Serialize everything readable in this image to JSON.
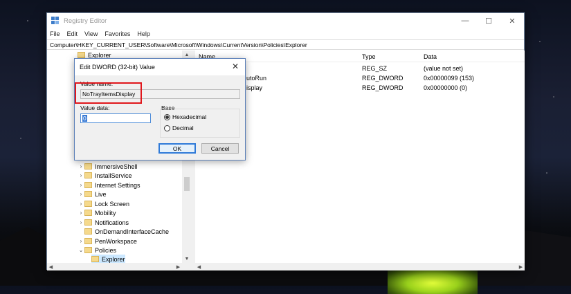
{
  "window": {
    "title": "Registry Editor",
    "controls": {
      "minimize": "—",
      "maximize": "☐",
      "close": "✕"
    }
  },
  "menu": [
    "File",
    "Edit",
    "View",
    "Favorites",
    "Help"
  ],
  "address": "Computer\\HKEY_CURRENT_USER\\Software\\Microsoft\\Windows\\CurrentVersion\\Policies\\Explorer",
  "tree": {
    "top_item": "Explorer",
    "items": [
      "ImmersiveShell",
      "InstallService",
      "Internet Settings",
      "Live",
      "Lock Screen",
      "Mobility",
      "Notifications",
      "OnDemandInterfaceCache",
      "PenWorkspace",
      "Policies",
      "Explorer"
    ],
    "expanded_item": "Policies",
    "selected_item": "Explorer"
  },
  "list": {
    "headers": {
      "name": "Name",
      "type": "Type",
      "data": "Data"
    },
    "rows": [
      {
        "name": "",
        "type": "REG_SZ",
        "data": "(value not set)"
      },
      {
        "name": "utoRun",
        "type": "REG_DWORD",
        "data": "0x00000099 (153)"
      },
      {
        "name": "isplay",
        "type": "REG_DWORD",
        "data": "0x00000000 (0)"
      }
    ]
  },
  "dialog": {
    "title": "Edit DWORD (32-bit) Value",
    "close": "✕",
    "value_name_label": "Value name:",
    "value_name": "NoTrayItemsDisplay",
    "value_data_label": "Value data:",
    "value_data": "0",
    "base_label": "Base",
    "base_options": [
      "Hexadecimal",
      "Decimal"
    ],
    "base_selected": "Hexadecimal",
    "ok": "OK",
    "cancel": "Cancel"
  },
  "colors": {
    "highlight": "#e0161b",
    "accent": "#2f7ad8",
    "folder": "#f5d98c"
  },
  "icons": {
    "app": "registry-editor-icon",
    "folder": "folder-icon"
  }
}
